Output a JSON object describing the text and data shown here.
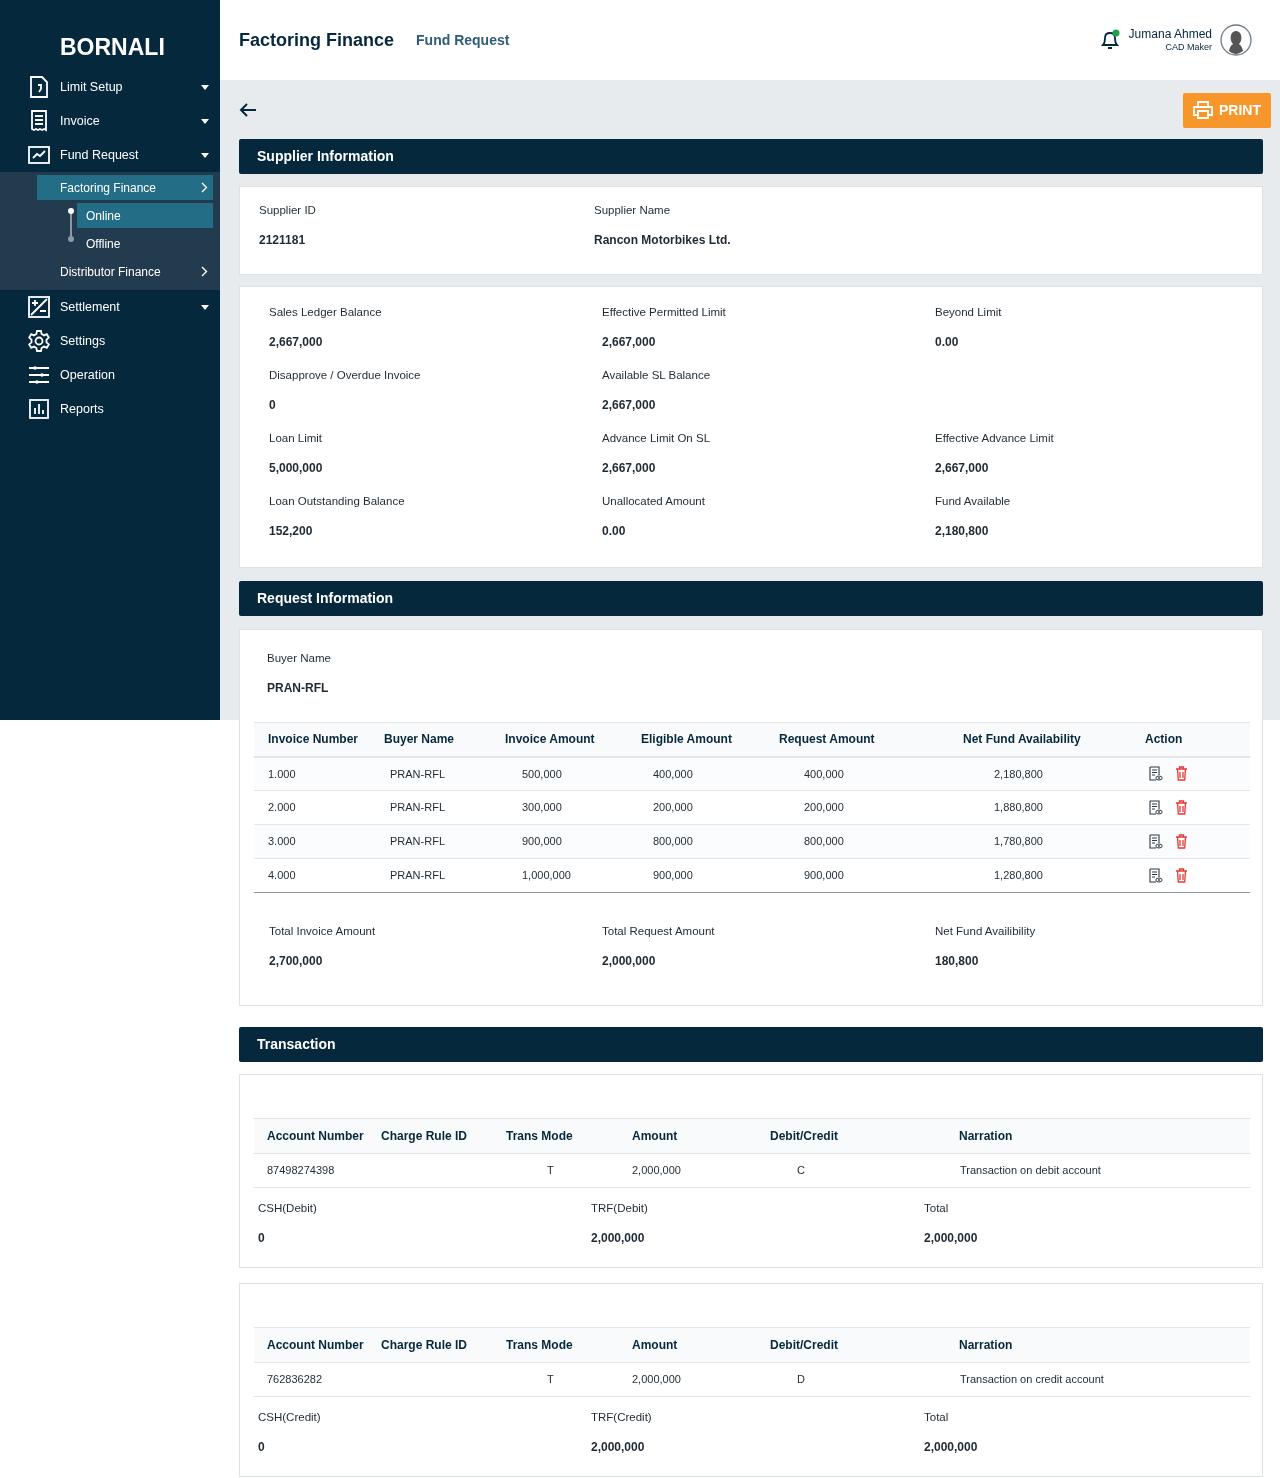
{
  "sidebar": {
    "brand": "BORNALI",
    "items": [
      {
        "label": "Limit Setup",
        "kind": "menu"
      },
      {
        "label": "Invoice",
        "kind": "menu"
      },
      {
        "label": "Fund Request",
        "kind": "menu",
        "expanded": true,
        "children": [
          {
            "label": "Factoring Finance",
            "selected": true,
            "expanded": true,
            "children": [
              {
                "label": "Online",
                "selected": true
              },
              {
                "label": "Offline",
                "selected": false
              }
            ]
          },
          {
            "label": "Distributor Finance",
            "selected": false
          }
        ]
      },
      {
        "label": "Settlement",
        "kind": "menu"
      },
      {
        "label": "Settings",
        "kind": "link"
      },
      {
        "label": "Operation",
        "kind": "link"
      },
      {
        "label": "Reports",
        "kind": "link"
      }
    ]
  },
  "header": {
    "title": "Factoring Finance",
    "subtitle": "Fund Request",
    "user_name": "Jumana Ahmed",
    "user_role": "CAD Maker",
    "has_notification": true
  },
  "print_button": "PRINT",
  "supplier": {
    "heading": "Supplier Information",
    "fields": [
      {
        "label": "Supplier ID",
        "value": "2121181"
      },
      {
        "label": "Supplier Name",
        "value": "Rancon Motorbikes Ltd."
      }
    ],
    "balance_rows": [
      [
        {
          "label": "Sales Ledger Balance",
          "value": "2,667,000"
        },
        {
          "label": "Effective Permitted Limit",
          "value": "2,667,000"
        },
        {
          "label": "Beyond Limit",
          "value": "0.00"
        }
      ],
      [
        {
          "label": "Disapprove / Overdue Invoice",
          "value": "0"
        },
        {
          "label": "Available SL Balance",
          "value": "2,667,000"
        }
      ],
      [
        {
          "label": "Loan Limit",
          "value": "5,000,000"
        },
        {
          "label": "Advance Limit On SL",
          "value": "2,667,000"
        },
        {
          "label": "Effective Advance Limit",
          "value": "2,667,000"
        }
      ],
      [
        {
          "label": "Loan Outstanding Balance",
          "value": "152,200"
        },
        {
          "label": "Unallocated Amount",
          "value": "0.00"
        },
        {
          "label": "Fund Available",
          "value": "2,180,800"
        }
      ]
    ]
  },
  "request": {
    "heading": "Request Information",
    "buyer_label": "Buyer Name",
    "buyer_value": "PRAN-RFL",
    "columns": [
      "Invoice Number",
      "Buyer Name",
      "Invoice Amount",
      "Eligible Amount",
      "Request Amount",
      "Net Fund Availability",
      "Action"
    ],
    "rows": [
      [
        "1.000",
        "PRAN-RFL",
        "500,000",
        "400,000",
        "400,000",
        "2,180,800"
      ],
      [
        "2.000",
        "PRAN-RFL",
        "300,000",
        "200,000",
        "200,000",
        "1,880,800"
      ],
      [
        "3.000",
        "PRAN-RFL",
        "900,000",
        "800,000",
        "800,000",
        "1,780,800"
      ],
      [
        "4.000",
        "PRAN-RFL",
        "1,000,000",
        "900,000",
        "900,000",
        "1,280,800"
      ]
    ],
    "totals": [
      {
        "label": "Total Invoice Amount",
        "value": "2,700,000"
      },
      {
        "label": "Total Request Amount",
        "value": "2,000,000"
      },
      {
        "label": "Net Fund Availibility",
        "value": "180,800"
      }
    ]
  },
  "transaction": {
    "heading": "Transaction",
    "blocks": [
      {
        "columns": [
          "Account Number",
          "Charge Rule ID",
          "Trans Mode",
          "Amount",
          "Debit/Credit",
          "Narration"
        ],
        "rows": [
          [
            "87498274398",
            "",
            "T",
            "2,000,000",
            "C",
            "Transaction on debit account"
          ]
        ],
        "totals": [
          {
            "label": "CSH(Debit)",
            "value": "0"
          },
          {
            "label": "TRF(Debit)",
            "value": "2,000,000"
          },
          {
            "label": "Total",
            "value": "2,000,000"
          }
        ]
      },
      {
        "columns": [
          "Account Number",
          "Charge Rule ID",
          "Trans Mode",
          "Amount",
          "Debit/Credit",
          "Narration"
        ],
        "rows": [
          [
            "762836282",
            "",
            "T",
            "2,000,000",
            "D",
            "Transaction on credit account"
          ]
        ],
        "totals": [
          {
            "label": "CSH(Credit)",
            "value": "0"
          },
          {
            "label": "TRF(Credit)",
            "value": "2,000,000"
          },
          {
            "label": "Total",
            "value": "2,000,000"
          }
        ]
      }
    ]
  }
}
